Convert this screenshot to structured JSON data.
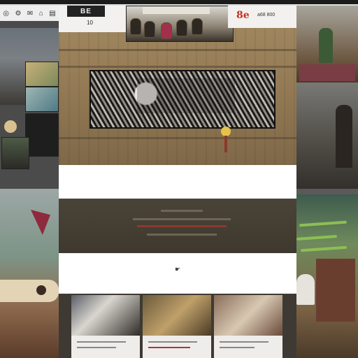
{
  "top_icons": [
    "◎",
    "⚙",
    "✉",
    "⌂",
    "▤"
  ],
  "header": {
    "logo_text": "BE",
    "nav_sub": "10",
    "photo_caption": "",
    "brand_mark": "8e",
    "brand_nav": "a68 800"
  },
  "hero": {
    "banner_label": ""
  },
  "section1": {
    "line1": "",
    "line2": ""
  },
  "section2": {
    "icon": "☛",
    "line1": ""
  },
  "right_tags": [
    "",
    "",
    ""
  ],
  "colors": {
    "accent": "#c5301f",
    "tag": "#8cbf55",
    "wood": "#947b55"
  }
}
